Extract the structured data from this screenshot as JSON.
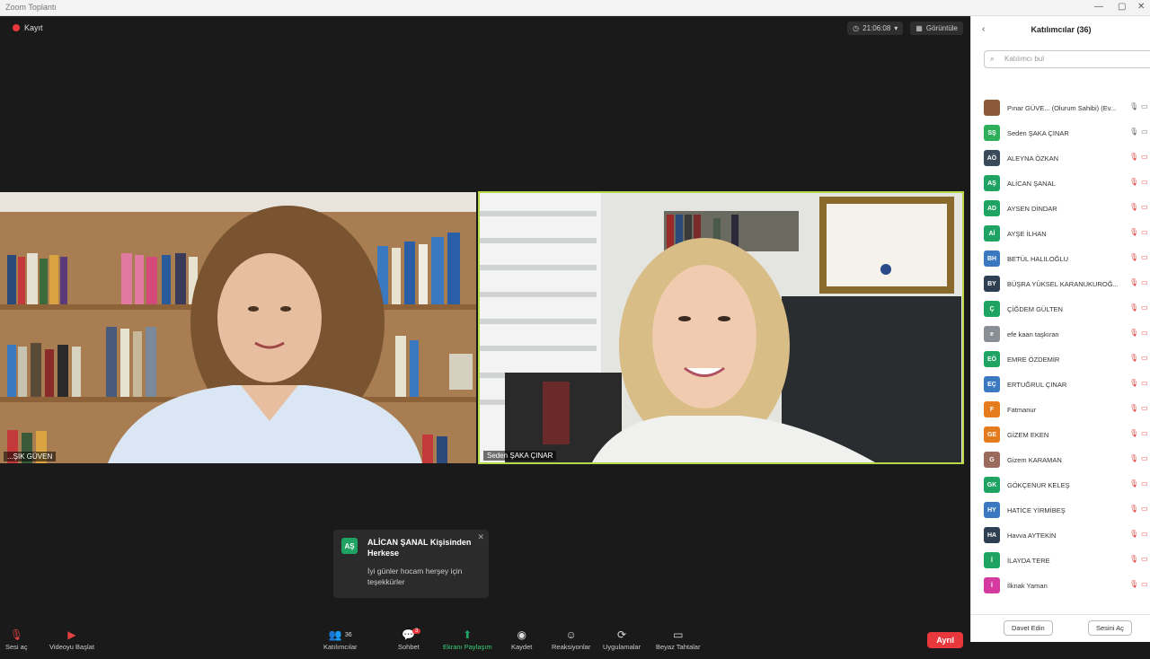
{
  "window": {
    "title": "Zoom Toplantı"
  },
  "meeting": {
    "recording_label": "Kayıt",
    "view_pill": "21:06:08",
    "gallery_label": "Görüntüle"
  },
  "tiles": [
    {
      "name": "...ŞIK GÜVEN"
    },
    {
      "name": "Seden ŞAKA ÇINAR"
    }
  ],
  "chat_toast": {
    "initials": "AŞ",
    "header": "ALİCAN ŞANAL Kişisinden Herkese",
    "message": "İyi günler hocam herşey için teşekkürler"
  },
  "toolbar": {
    "mute": "Sesi aç",
    "video": "Videoyu Başlat",
    "participants": "Katılımcılar",
    "participants_count": "36",
    "chat": "Sohbet",
    "chat_badge": "3",
    "share": "Ekranı Paylaşım",
    "record": "Kaydet",
    "reactions": "Reaksiyonlar",
    "apps": "Uygulamalar",
    "whiteboard": "Beyaz Tahtalar",
    "leave": "Ayrıl"
  },
  "panel": {
    "title": "Katılımcılar (36)",
    "search_placeholder": "Katılımcı bul",
    "participants": [
      {
        "initials": "",
        "name": "Pınar GÜVE... (Olurum Sahibi) (Ev...",
        "color": "#8a5a3a"
      },
      {
        "initials": "SŞ",
        "name": "Seden ŞAKA ÇINAR",
        "color": "#2fae5c"
      },
      {
        "initials": "AÖ",
        "name": "ALEYNA ÖZKAN",
        "color": "#3a4a5a"
      },
      {
        "initials": "AŞ",
        "name": "ALİCAN ŞANAL",
        "color": "#1ea362"
      },
      {
        "initials": "AD",
        "name": "AYSEN DİNDAR",
        "color": "#1ea362"
      },
      {
        "initials": "Aİ",
        "name": "AYŞE İLHAN",
        "color": "#1ea362"
      },
      {
        "initials": "BH",
        "name": "BETÜL HALILOĞLU",
        "color": "#3a79c2"
      },
      {
        "initials": "BY",
        "name": "BÜŞRA YÜKSEL KARANUKUROĞ...",
        "color": "#2e3f52"
      },
      {
        "initials": "Ç",
        "name": "ÇİĞDEM GÜLTEN",
        "color": "#1ea362"
      },
      {
        "initials": "e",
        "name": "efe kaan taşkıran",
        "color": "#8a8f96"
      },
      {
        "initials": "EÖ",
        "name": "EMRE ÖZDEMİR",
        "color": "#1ea362"
      },
      {
        "initials": "EÇ",
        "name": "ERTUĞRUL ÇINAR",
        "color": "#3a79c2"
      },
      {
        "initials": "F",
        "name": "Fatmanur",
        "color": "#e47b1c"
      },
      {
        "initials": "GE",
        "name": "GİZEM EKEN",
        "color": "#e47b1c"
      },
      {
        "initials": "G",
        "name": "Gizem KARAMAN",
        "color": "#9a6a5a"
      },
      {
        "initials": "GK",
        "name": "GÖKÇENUR KELEŞ",
        "color": "#1ea362"
      },
      {
        "initials": "HY",
        "name": "HATİCE YİRMİBEŞ",
        "color": "#3a79c2"
      },
      {
        "initials": "HA",
        "name": "Havva AYTEKİN",
        "color": "#2e3f52"
      },
      {
        "initials": "İ",
        "name": "İLAYDA TERE",
        "color": "#1ea362"
      },
      {
        "initials": "İ",
        "name": "İlknak Yaman",
        "color": "#d43aa0"
      }
    ],
    "invite_button": "Davet Edin",
    "unmute_all_button": "Sesini Aç"
  }
}
